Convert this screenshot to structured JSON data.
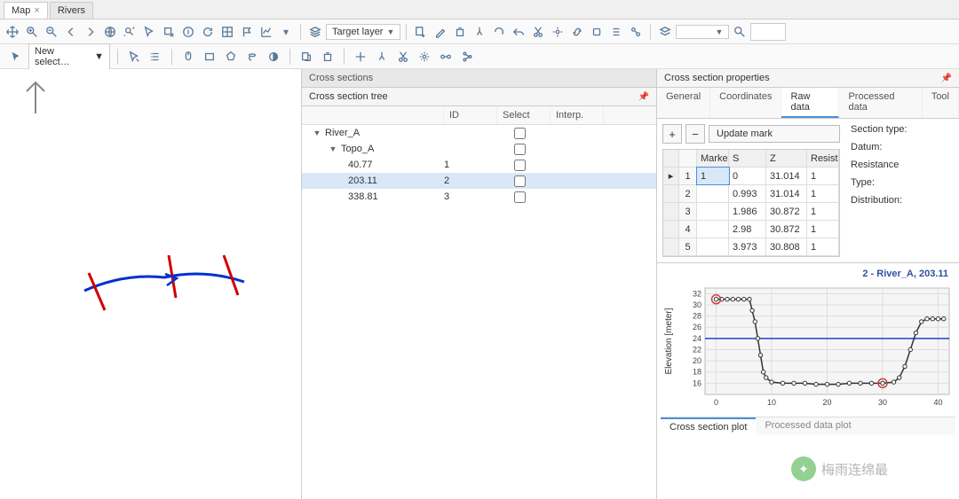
{
  "tabs": [
    {
      "label": "Map",
      "active": true
    },
    {
      "label": "Rivers",
      "active": false
    }
  ],
  "toolbar": {
    "target_layer": "Target layer"
  },
  "toolbar2": {
    "select_mode": "New select…"
  },
  "sections_panel": {
    "title": "Cross sections",
    "tree_title": "Cross section tree",
    "columns": {
      "name": "",
      "id": "ID",
      "select": "Select",
      "interp": "Interp."
    },
    "tree": [
      {
        "label": "River_A",
        "depth": 0,
        "expand": "▼"
      },
      {
        "label": "Topo_A",
        "depth": 1,
        "expand": "▼"
      },
      {
        "label": "40.77",
        "depth": 2,
        "id": "1",
        "selected": false
      },
      {
        "label": "203.11",
        "depth": 2,
        "id": "2",
        "selected": true
      },
      {
        "label": "338.81",
        "depth": 2,
        "id": "3",
        "selected": false
      }
    ]
  },
  "props_panel": {
    "title": "Cross section properties",
    "tabs": [
      "General",
      "Coordinates",
      "Raw data",
      "Processed data",
      "Tool"
    ],
    "active_tab": "Raw data",
    "buttons": {
      "plus": "+",
      "minus": "−",
      "update": "Update mark"
    },
    "table": {
      "headers": [
        "",
        "Marke",
        "S",
        "Z",
        "Resista"
      ],
      "rows": [
        {
          "idx": "1",
          "marker": "1",
          "s": "0",
          "z": "31.014",
          "r": "1",
          "current": true
        },
        {
          "idx": "2",
          "marker": "",
          "s": "0.993",
          "z": "31.014",
          "r": "1"
        },
        {
          "idx": "3",
          "marker": "",
          "s": "1.986",
          "z": "30.872",
          "r": "1"
        },
        {
          "idx": "4",
          "marker": "",
          "s": "2.98",
          "z": "30.872",
          "r": "1"
        },
        {
          "idx": "5",
          "marker": "",
          "s": "3.973",
          "z": "30.808",
          "r": "1"
        }
      ]
    },
    "labels": {
      "section_type": "Section type:",
      "datum": "Datum:",
      "resistance": "Resistance",
      "type": "Type:",
      "distribution": "Distribution:"
    },
    "chart_tabs": [
      "Cross section plot",
      "Processed data plot"
    ],
    "active_chart_tab": "Cross section plot"
  },
  "chart_data": {
    "type": "line",
    "title": "2 - River_A, 203.11",
    "xlabel": "",
    "ylabel": "Elevation [meter]",
    "x_ticks": [
      0,
      10,
      20,
      30,
      40
    ],
    "y_ticks": [
      16,
      18,
      20,
      22,
      24,
      26,
      28,
      30,
      32
    ],
    "ylim": [
      14,
      33
    ],
    "xlim": [
      -2,
      42
    ],
    "water_level": 24,
    "series": [
      {
        "name": "profile",
        "x": [
          0,
          1,
          2,
          3,
          4,
          5,
          6,
          6.5,
          7,
          7.5,
          8,
          8.5,
          9,
          10,
          12,
          14,
          16,
          18,
          20,
          22,
          24,
          26,
          28,
          30,
          32,
          33,
          34,
          35,
          36,
          37,
          38,
          39,
          40,
          41
        ],
        "y": [
          31,
          31,
          31,
          31,
          31,
          31,
          31,
          29,
          27,
          24,
          21,
          18,
          17,
          16.2,
          16,
          16,
          16,
          15.8,
          15.8,
          15.8,
          16,
          16,
          16,
          16,
          16.2,
          17,
          19,
          22,
          25,
          27,
          27.5,
          27.5,
          27.5,
          27.5
        ]
      }
    ],
    "markers": [
      {
        "x": 0,
        "y": 31,
        "label": "1"
      },
      {
        "x": 30,
        "y": 16,
        "label": ""
      }
    ]
  },
  "watermark": "梅雨连绵最"
}
